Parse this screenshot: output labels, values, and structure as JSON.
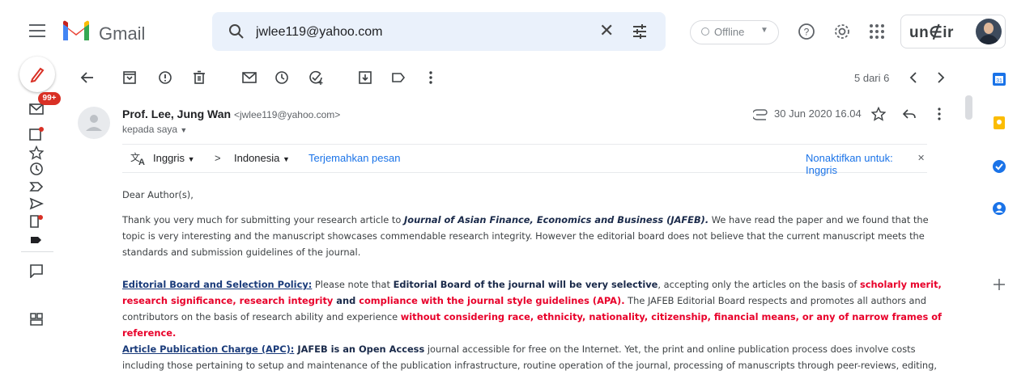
{
  "app": {
    "brand": "Gmail",
    "colors": {
      "accent": "#1a73e8",
      "badge": "#d93025",
      "red_text": "#e8002a",
      "search_bg": "#eaf1fb"
    }
  },
  "search": {
    "value": "jwlee119@yahoo.com"
  },
  "header": {
    "status_label": "Offline",
    "account_logo_text": "un∉ir"
  },
  "rail": {
    "badge": "99+",
    "icons": [
      "pencil-icon",
      "mail-icon",
      "inbox-icon",
      "star-icon",
      "clock-icon",
      "label-icon",
      "send-icon",
      "draft-icon",
      "tag-icon",
      "chat-icon",
      "spaces-icon"
    ]
  },
  "toolbar": {
    "icons": [
      "back-arrow-icon",
      "archive-icon",
      "report-spam-icon",
      "delete-icon",
      "mark-unread-icon",
      "snooze-icon",
      "add-task-icon",
      "move-to-icon",
      "label-icon",
      "more-icon"
    ],
    "pager": "5 dari 6"
  },
  "email": {
    "sender_name": "Prof. Lee, Jung Wan",
    "sender_address": "<jwlee119@yahoo.com>",
    "to_me": "kepada saya",
    "datetime": "30 Jun 2020 16.04",
    "translate": {
      "from": "Inggris",
      "to": "Indonesia",
      "action": "Terjemahkan pesan",
      "disable": "Nonaktifkan untuk: Inggris"
    },
    "greeting": "Dear Author(s),",
    "p1": {
      "a": "Thank you very much for submitting your research article to ",
      "journal": "Journal of Asian Finance, Economics and Business (JAFEB).",
      "b": " We have read the paper and we found that the topic is very interesting and the manuscript showcases commendable research integrity. However the editorial board does not believe that the current manuscript meets the standards and submission guidelines of the journal."
    },
    "p2": {
      "heading": "Editorial Board and Selection Policy:",
      "a": " Please note that ",
      "b1": "Editorial Board of the journal will be very selective",
      "c": ", accepting only the articles on the basis of ",
      "r1": "scholarly merit, research significance",
      "d": ", ",
      "r2": "research integrity",
      "e": " and ",
      "r3": "compliance with the journal style guidelines (APA).",
      "f": " The JAFEB Editorial Board respects and promotes all authors and contributors on the basis of research ability and experience ",
      "r4": "without considering race, ethnicity, nationality, citizenship, financial means, or any of narrow frames of reference."
    },
    "p3": {
      "heading": "Article Publication Charge (APC):",
      "b1": " JAFEB is an Open Access",
      "a": " journal accessible for free on the Internet. Yet, the print and online publication process does involve costs including those pertaining to setup and maintenance of the publication infrastructure, routine operation of the journal, processing of manuscripts through peer-reviews, editing,"
    }
  },
  "right_panel": {
    "icons": [
      "calendar-icon",
      "keep-icon",
      "tasks-icon",
      "contacts-icon",
      "add-addon-icon"
    ]
  }
}
